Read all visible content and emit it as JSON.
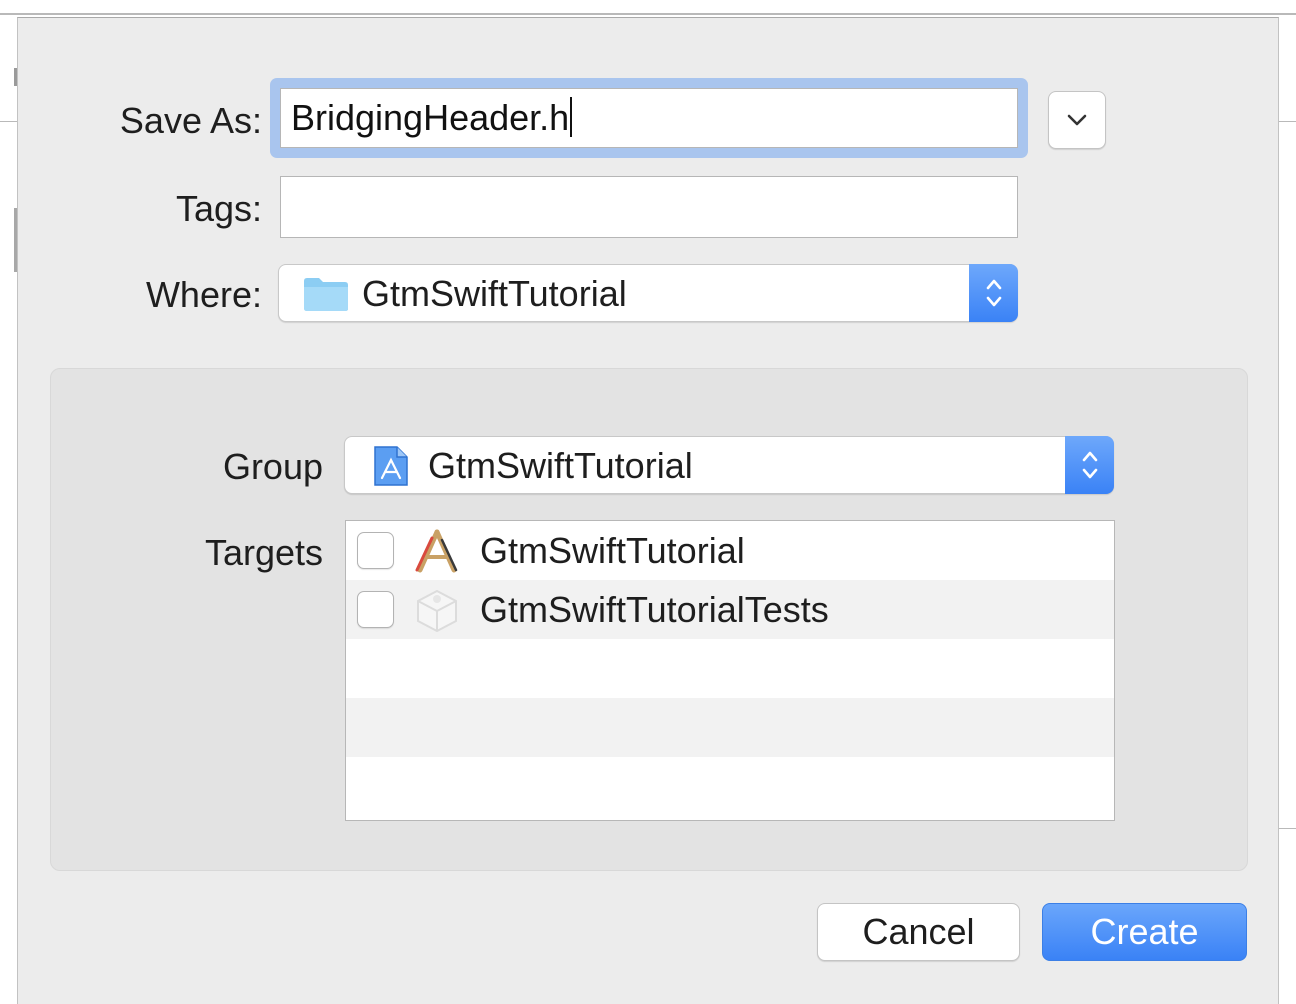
{
  "form": {
    "save_as_label": "Save As:",
    "save_as_value": "BridgingHeader.h",
    "tags_label": "Tags:",
    "tags_value": "",
    "where_label": "Where:",
    "where_value": "GtmSwiftTutorial"
  },
  "options": {
    "group_label": "Group",
    "group_value": "GtmSwiftTutorial",
    "targets_label": "Targets",
    "targets": [
      {
        "label": "GtmSwiftTutorial",
        "checked": false,
        "icon": "app-target-icon"
      },
      {
        "label": "GtmSwiftTutorialTests",
        "checked": false,
        "icon": "test-bundle-icon"
      }
    ]
  },
  "buttons": {
    "cancel": "Cancel",
    "create": "Create"
  },
  "colors": {
    "accent": "#3a82f6",
    "focus_ring": "#a9c5ee",
    "sheet_bg": "#ececec",
    "panel_bg": "#e3e3e3"
  }
}
